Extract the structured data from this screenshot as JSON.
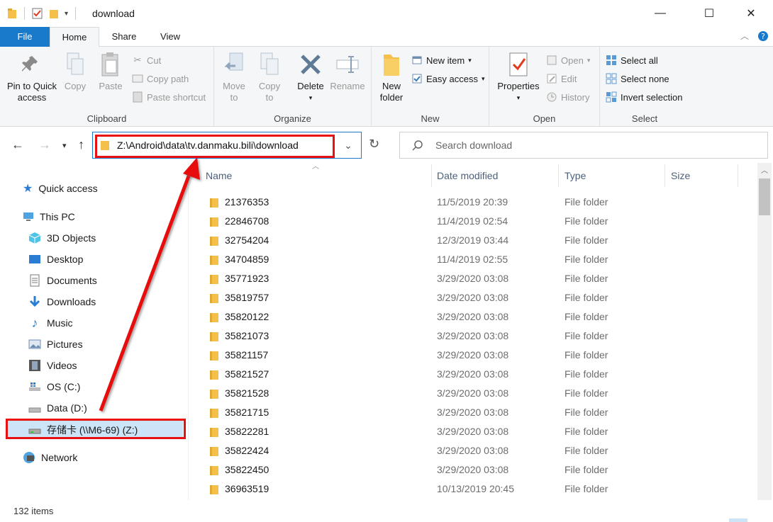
{
  "window": {
    "title": "download",
    "minimize_glyph": "—",
    "maximize_glyph": "☐",
    "close_glyph": "✕"
  },
  "ribbon": {
    "tabs": [
      "File",
      "Home",
      "Share",
      "View"
    ],
    "clipboard": {
      "label": "Clipboard",
      "pin_line1": "Pin to Quick",
      "pin_line2": "access",
      "copy": "Copy",
      "paste": "Paste",
      "cut": "Cut",
      "copy_path": "Copy path",
      "paste_shortcut": "Paste shortcut"
    },
    "organize": {
      "label": "Organize",
      "move_to_1": "Move",
      "move_to_2": "to",
      "copy_to_1": "Copy",
      "copy_to_2": "to",
      "delete": "Delete",
      "rename": "Rename"
    },
    "new": {
      "label": "New",
      "new_folder_1": "New",
      "new_folder_2": "folder",
      "new_item": "New item",
      "easy_access": "Easy access"
    },
    "open": {
      "label": "Open",
      "properties": "Properties",
      "open": "Open",
      "edit": "Edit",
      "history": "History"
    },
    "select": {
      "label": "Select",
      "select_all": "Select all",
      "select_none": "Select none",
      "invert_selection": "Invert selection"
    }
  },
  "address": {
    "path": "Z:\\Android\\data\\tv.danmaku.bili\\download",
    "search_placeholder": "Search download"
  },
  "navpane": {
    "quick_access": "Quick access",
    "this_pc": "This PC",
    "items": [
      "3D Objects",
      "Desktop",
      "Documents",
      "Downloads",
      "Music",
      "Pictures",
      "Videos",
      "OS (C:)",
      "Data (D:)",
      "存储卡 (\\\\M6-69) (Z:)"
    ],
    "network": "Network"
  },
  "columns": {
    "name": "Name",
    "date": "Date modified",
    "type": "Type",
    "size": "Size"
  },
  "files": [
    {
      "name": "21376353",
      "date": "11/5/2019 20:39",
      "type": "File folder"
    },
    {
      "name": "22846708",
      "date": "11/4/2019 02:54",
      "type": "File folder"
    },
    {
      "name": "32754204",
      "date": "12/3/2019 03:44",
      "type": "File folder"
    },
    {
      "name": "34704859",
      "date": "11/4/2019 02:55",
      "type": "File folder"
    },
    {
      "name": "35771923",
      "date": "3/29/2020 03:08",
      "type": "File folder"
    },
    {
      "name": "35819757",
      "date": "3/29/2020 03:08",
      "type": "File folder"
    },
    {
      "name": "35820122",
      "date": "3/29/2020 03:08",
      "type": "File folder"
    },
    {
      "name": "35821073",
      "date": "3/29/2020 03:08",
      "type": "File folder"
    },
    {
      "name": "35821157",
      "date": "3/29/2020 03:08",
      "type": "File folder"
    },
    {
      "name": "35821527",
      "date": "3/29/2020 03:08",
      "type": "File folder"
    },
    {
      "name": "35821528",
      "date": "3/29/2020 03:08",
      "type": "File folder"
    },
    {
      "name": "35821715",
      "date": "3/29/2020 03:08",
      "type": "File folder"
    },
    {
      "name": "35822281",
      "date": "3/29/2020 03:08",
      "type": "File folder"
    },
    {
      "name": "35822424",
      "date": "3/29/2020 03:08",
      "type": "File folder"
    },
    {
      "name": "35822450",
      "date": "3/29/2020 03:08",
      "type": "File folder"
    },
    {
      "name": "36963519",
      "date": "10/13/2019 20:45",
      "type": "File folder"
    }
  ],
  "status": {
    "item_count": "132 items"
  },
  "colors": {
    "accent": "#1979ca",
    "annotation": "#e81010",
    "folder": "#f5c04a"
  }
}
